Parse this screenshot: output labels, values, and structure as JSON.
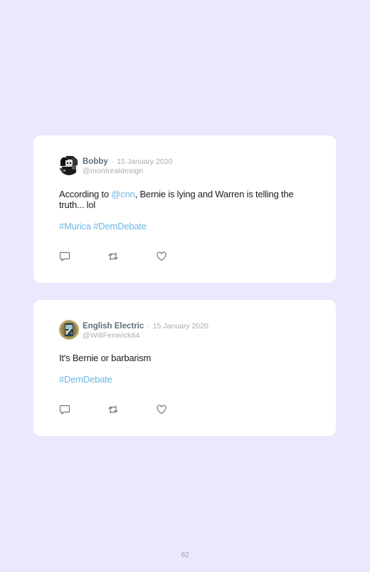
{
  "tweets": [
    {
      "author": "Bobby",
      "separator": "·",
      "date": "15 January 2020",
      "handle": "@montrealdesign",
      "text_before": "According to ",
      "mention": "@cnn",
      "text_after": ", Bernie is lying and Warren is telling the truth... lol",
      "hashtags": [
        "#Murica",
        "#DemDebate"
      ],
      "avatar_icon": "pixel-portrait-avatar"
    },
    {
      "author": "English Electric",
      "separator": "·",
      "date": "15 January 2020",
      "handle": "@WillFenwick84",
      "text": "It's Bernie or barbarism",
      "hashtags": [
        "#DemDebate"
      ],
      "avatar_icon": "locomotive-badge-avatar"
    }
  ],
  "actions": [
    "reply-icon",
    "retweet-icon",
    "like-icon"
  ],
  "colors": {
    "background": "#ebe7fd",
    "card": "#ffffff",
    "link": "#6ab8e4",
    "author": "#5e6f7c",
    "muted": "#a6acb3"
  },
  "page_number": "62"
}
